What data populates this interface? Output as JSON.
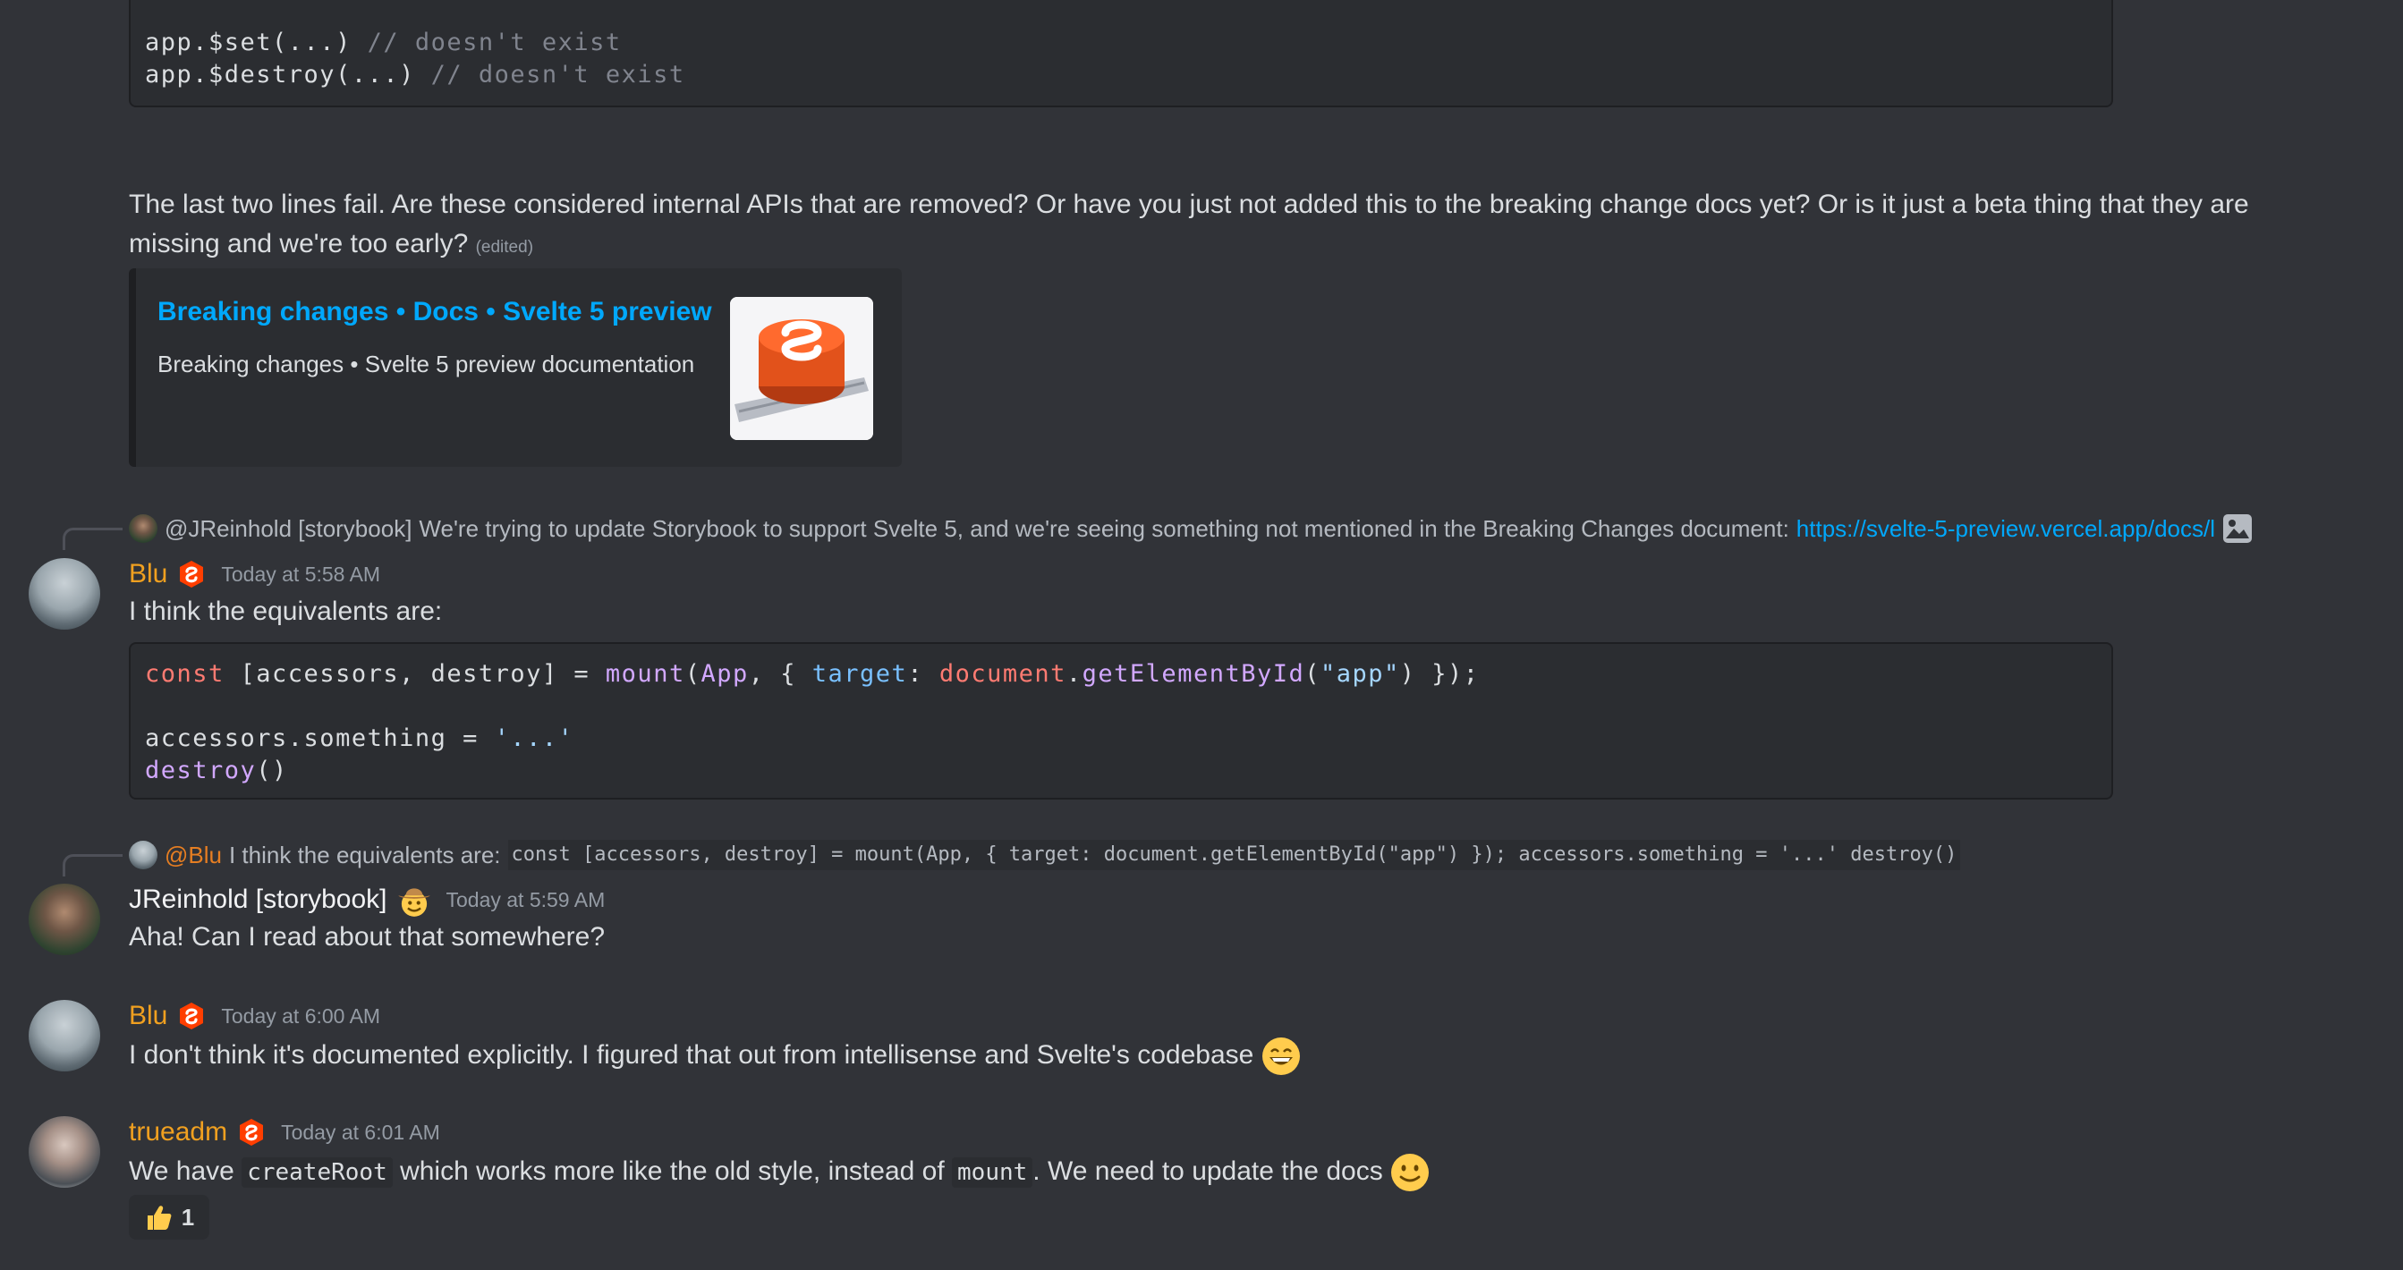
{
  "top_code": {
    "lines": [
      {
        "code": "app.$set(...)",
        "comment": " // doesn't exist"
      },
      {
        "code": "app.$destroy(...)",
        "comment": " // doesn't exist"
      }
    ]
  },
  "question_message": {
    "text_line1": "The last two lines fail. Are these considered internal APIs that are removed? Or have you just not added this to the breaking change docs yet? Or is it just a beta thing that they are",
    "text_line2": "missing and we're too early?",
    "edited": "(edited)"
  },
  "embed": {
    "title": "Breaking changes • Docs • Svelte 5 preview",
    "description": "Breaking changes • Svelte 5 preview documentation",
    "thumbnail_icon": "svelte-logo"
  },
  "messages": [
    {
      "reply": {
        "mention": "@JReinhold [storybook]",
        "text": "We're trying to update Storybook to support Svelte 5, and we're seeing something not mentioned in the Breaking Changes document:",
        "link": "https://svelte-5-preview.vercel.app/docs/l"
      },
      "username": "Blu",
      "timestamp": "Today at 5:58 AM",
      "text": "I think the equivalents are:",
      "code": {
        "line1": {
          "kw": "const",
          "a": " [accessors, destroy] = ",
          "fn": "mount",
          "b": "(",
          "app": "App",
          "c": ", { ",
          "prop": "target",
          "d": ": ",
          "builtin": "document",
          "e": ".",
          "fn2": "getElementById",
          "f": "(",
          "str": "\"app\"",
          "g": ") });"
        },
        "line3": {
          "a": "accessors.something = ",
          "str": "'...'"
        },
        "line4": {
          "fn": "destroy",
          "a": "()"
        }
      }
    },
    {
      "reply": {
        "mention": "@Blu",
        "text": "I think the equivalents are:",
        "code": "const [accessors, destroy] = mount(App, { target: document.getElementById(\"app\") });  accessors.something = '...' destroy()"
      },
      "username": "JReinhold [storybook]",
      "timestamp": "Today at 5:59 AM",
      "text": "Aha! Can I read about that somewhere?"
    },
    {
      "username": "Blu",
      "timestamp": "Today at 6:00 AM",
      "text": "I don't think it's documented explicitly. I figured that out from intellisense and Svelte's codebase"
    },
    {
      "username": "trueadm",
      "timestamp": "Today at 6:01 AM",
      "text_before": "We have ",
      "code1": "createRoot",
      "text_mid": " which works more like the old style, instead of ",
      "code2": "mount",
      "text_after": ". We need to update the docs",
      "reaction": {
        "emoji": "thumbs-up",
        "count": "1"
      }
    }
  ],
  "colors": {
    "background": "#313338",
    "link": "#00a8fc",
    "username_orange": "#f0a020",
    "svelte": "#ff3e00"
  }
}
